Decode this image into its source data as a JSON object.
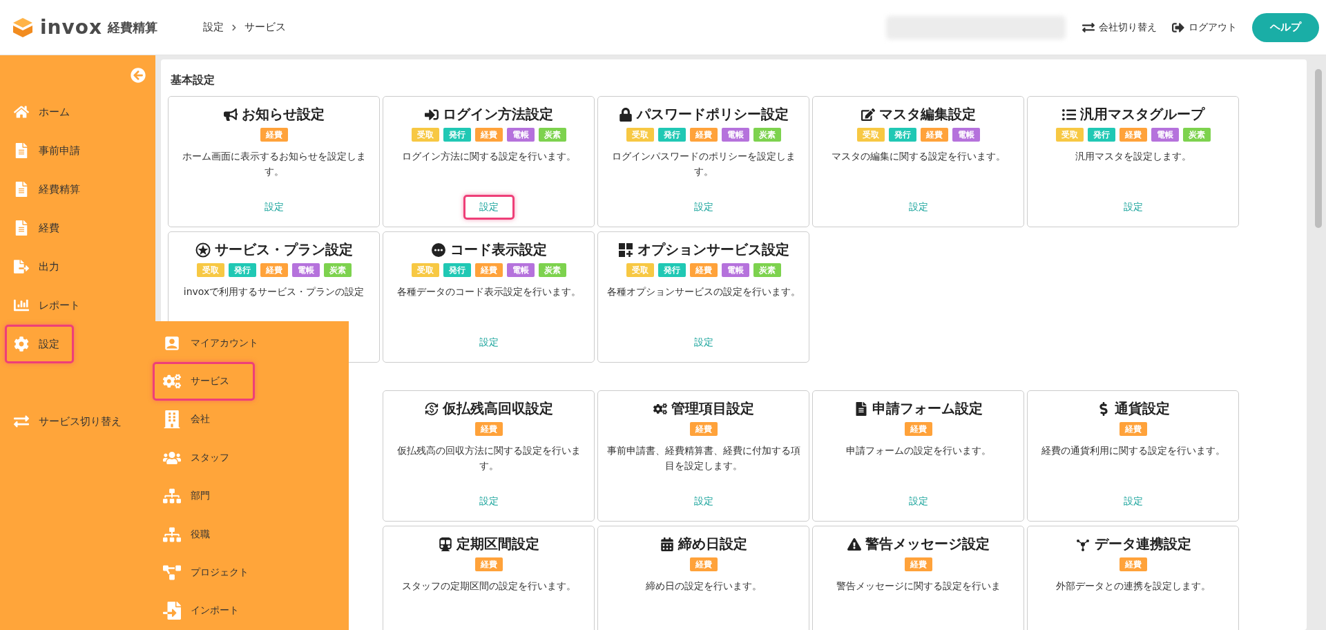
{
  "header": {
    "logo_text": "invox",
    "product": "経費精算",
    "breadcrumb": [
      "設定",
      "サービス"
    ],
    "actions": [
      {
        "kind": "switch",
        "label": "会社切り替え"
      },
      {
        "kind": "logout",
        "label": "ログアウト"
      }
    ],
    "help_button": "ヘルプ"
  },
  "sidebar": {
    "items": [
      {
        "label": "ホーム",
        "selected": false
      },
      {
        "label": "事前申請",
        "selected": false
      },
      {
        "label": "経費精算",
        "selected": false
      },
      {
        "label": "経費",
        "selected": false
      },
      {
        "label": "出力",
        "selected": false
      },
      {
        "label": "レポート",
        "selected": false
      },
      {
        "label": "設定",
        "selected": true
      },
      {
        "label": "サービス切り替え",
        "selected": false
      }
    ]
  },
  "submenu": {
    "items": [
      {
        "label": "マイアカウント",
        "selected": false
      },
      {
        "label": "サービス",
        "selected": true
      },
      {
        "label": "会社",
        "selected": false
      },
      {
        "label": "スタッフ",
        "selected": false
      },
      {
        "label": "部門",
        "selected": false
      },
      {
        "label": "役職",
        "selected": false
      },
      {
        "label": "プロジェクト",
        "selected": false
      },
      {
        "label": "インポート",
        "selected": false
      }
    ]
  },
  "sections": [
    {
      "title": "基本設定",
      "cards": [
        {
          "title": "お知らせ設定",
          "tags": [
            {
              "label": "経費",
              "color": "#ffa23a"
            }
          ],
          "description": "ホーム画面に表示するお知らせを設定します。",
          "link": "設定"
        },
        {
          "title": "ログイン方法設定",
          "tags": [
            {
              "label": "受取",
              "color": "#f7c843"
            },
            {
              "label": "発行",
              "color": "#20c8b4"
            },
            {
              "label": "経費",
              "color": "#ffa23a"
            },
            {
              "label": "電帳",
              "color": "#b572dc"
            },
            {
              "label": "炭素",
              "color": "#7dd24e"
            }
          ],
          "description": "ログイン方法に関する設定を行います。",
          "link": "設定",
          "highlighted": true
        },
        {
          "title": "パスワードポリシー設定",
          "tags": [
            {
              "label": "受取",
              "color": "#f7c843"
            },
            {
              "label": "発行",
              "color": "#20c8b4"
            },
            {
              "label": "経費",
              "color": "#ffa23a"
            },
            {
              "label": "電帳",
              "color": "#b572dc"
            },
            {
              "label": "炭素",
              "color": "#7dd24e"
            }
          ],
          "description": "ログインパスワードのポリシーを設定します。",
          "link": "設定"
        },
        {
          "title": "マスタ編集設定",
          "tags": [
            {
              "label": "受取",
              "color": "#f7c843"
            },
            {
              "label": "発行",
              "color": "#20c8b4"
            },
            {
              "label": "経費",
              "color": "#ffa23a"
            },
            {
              "label": "電帳",
              "color": "#b572dc"
            }
          ],
          "description": "マスタの編集に関する設定を行います。",
          "link": "設定"
        },
        {
          "title": "汎用マスタグループ",
          "tags": [
            {
              "label": "受取",
              "color": "#f7c843"
            },
            {
              "label": "発行",
              "color": "#20c8b4"
            },
            {
              "label": "経費",
              "color": "#ffa23a"
            },
            {
              "label": "電帳",
              "color": "#b572dc"
            },
            {
              "label": "炭素",
              "color": "#7dd24e"
            }
          ],
          "description": "汎用マスタを設定します。",
          "link": "設定"
        },
        {
          "title": "サービス・プラン設定",
          "tags": [
            {
              "label": "受取",
              "color": "#f7c843"
            },
            {
              "label": "発行",
              "color": "#20c8b4"
            },
            {
              "label": "経費",
              "color": "#ffa23a"
            },
            {
              "label": "電帳",
              "color": "#b572dc"
            },
            {
              "label": "炭素",
              "color": "#7dd24e"
            }
          ],
          "description": "invoxで利用するサービス・プランの設定"
        },
        {
          "title": "コード表示設定",
          "tags": [
            {
              "label": "受取",
              "color": "#f7c843"
            },
            {
              "label": "発行",
              "color": "#20c8b4"
            },
            {
              "label": "経費",
              "color": "#ffa23a"
            },
            {
              "label": "電帳",
              "color": "#b572dc"
            },
            {
              "label": "炭素",
              "color": "#7dd24e"
            }
          ],
          "description": "各種データのコード表示設定を行います。",
          "link": "設定"
        },
        {
          "title": "オプションサービス設定",
          "tags": [
            {
              "label": "受取",
              "color": "#f7c843"
            },
            {
              "label": "発行",
              "color": "#20c8b4"
            },
            {
              "label": "経費",
              "color": "#ffa23a"
            },
            {
              "label": "電帳",
              "color": "#b572dc"
            },
            {
              "label": "炭素",
              "color": "#7dd24e"
            }
          ],
          "description": "各種オプションサービスの設定を行います。",
          "link": "設定"
        }
      ]
    },
    {
      "cards": [
        {
          "title": "仮払残高回収設定",
          "tags": [
            {
              "label": "経費",
              "color": "#ffa23a"
            }
          ],
          "description": "仮払残高の回収方法に関する設定を行います。",
          "link": "設定"
        },
        {
          "title": "管理項目設定",
          "tags": [
            {
              "label": "経費",
              "color": "#ffa23a"
            }
          ],
          "description": "事前申請書、経費精算書、経費に付加する項目を設定します。",
          "link": "設定"
        },
        {
          "title": "申請フォーム設定",
          "tags": [
            {
              "label": "経費",
              "color": "#ffa23a"
            }
          ],
          "description": "申請フォームの設定を行います。",
          "link": "設定"
        },
        {
          "title": "通貨設定",
          "tags": [
            {
              "label": "経費",
              "color": "#ffa23a"
            }
          ],
          "description": "経費の通貨利用に関する設定を行います。",
          "link": "設定"
        },
        {
          "title": "定期区間設定",
          "tags": [
            {
              "label": "経費",
              "color": "#ffa23a"
            }
          ],
          "description": "スタッフの定期区間の設定を行います。"
        },
        {
          "title": "締め日設定",
          "tags": [
            {
              "label": "経費",
              "color": "#ffa23a"
            }
          ],
          "description": "締め日の設定を行います。"
        },
        {
          "title": "警告メッセージ設定",
          "tags": [
            {
              "label": "経費",
              "color": "#ffa23a"
            }
          ],
          "description": "警告メッセージに関する設定を行いま"
        },
        {
          "title": "データ連携設定",
          "tags": [
            {
              "label": "経費",
              "color": "#ffa23a"
            }
          ],
          "description": "外部データとの連携を設定します。"
        }
      ]
    }
  ]
}
